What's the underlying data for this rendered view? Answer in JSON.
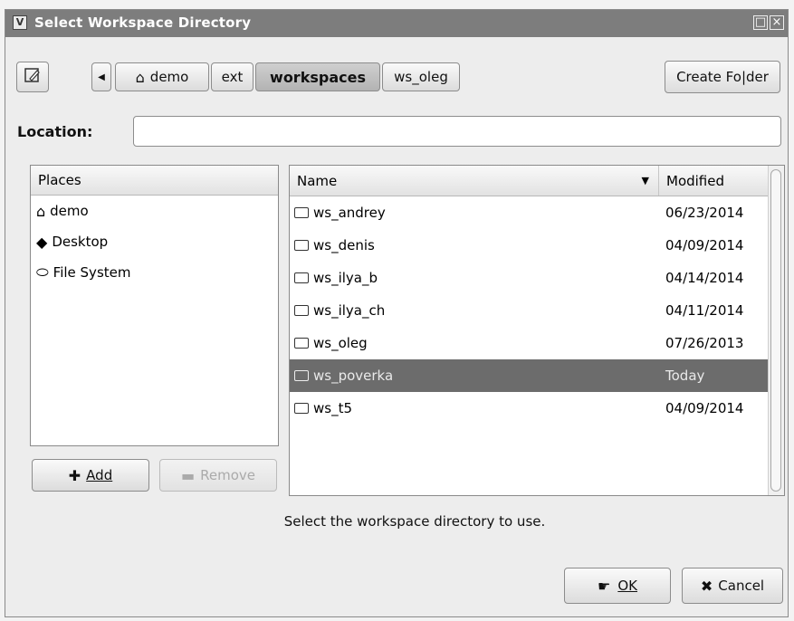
{
  "window": {
    "title": "Select Workspace Directory"
  },
  "path_bar": {
    "crumbs": [
      "demo",
      "ext",
      "workspaces",
      "ws_oleg"
    ],
    "create_folder": "Create Fo|der"
  },
  "location": {
    "label": "Location:",
    "value": ""
  },
  "places": {
    "header": "Places",
    "items": [
      "demo",
      "Desktop",
      "File System"
    ],
    "add": "Add",
    "remove": "Remove"
  },
  "files": {
    "col_name": "Name",
    "col_modified": "Modified",
    "rows": [
      {
        "name": "ws_andrey",
        "modified": "06/23/2014"
      },
      {
        "name": "ws_denis",
        "modified": "04/09/2014"
      },
      {
        "name": "ws_ilya_b",
        "modified": "04/14/2014"
      },
      {
        "name": "ws_ilya_ch",
        "modified": "04/11/2014"
      },
      {
        "name": "ws_oleg",
        "modified": "07/26/2013"
      },
      {
        "name": "ws_poverka",
        "modified": "Today"
      },
      {
        "name": "ws_t5",
        "modified": "04/09/2014"
      }
    ]
  },
  "hint": "Select the workspace directory to use.",
  "buttons": {
    "ok": "OK",
    "cancel": "Cancel"
  }
}
